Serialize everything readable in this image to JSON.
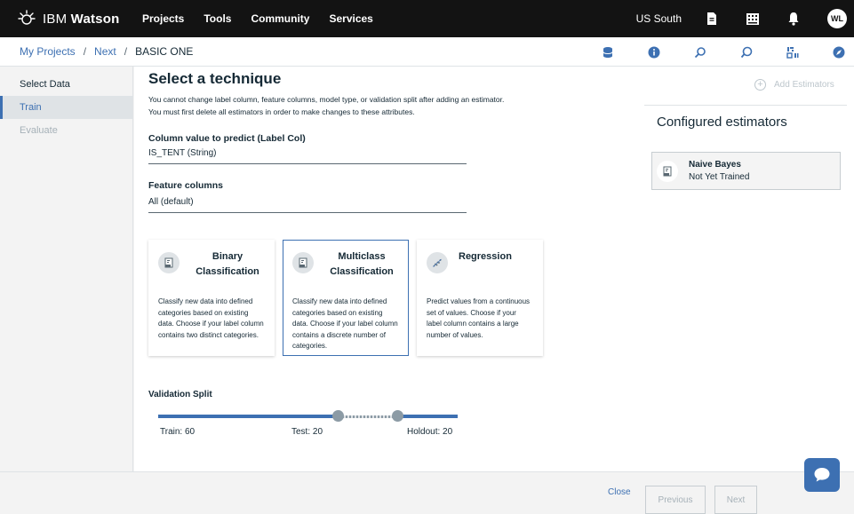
{
  "topbar": {
    "brand_light": "IBM ",
    "brand_bold": "Watson",
    "nav": [
      "Projects",
      "Tools",
      "Community",
      "Services"
    ],
    "region": "US South",
    "avatar_initials": "WL",
    "icons": [
      "document-icon",
      "apps-grid-icon",
      "notification-bell-icon"
    ]
  },
  "breadcrumb": {
    "items": [
      "My Projects",
      "Next"
    ],
    "separator": "/",
    "current": "BASIC ONE"
  },
  "toolbar_icons": [
    "database-icon",
    "info-icon",
    "search-icon",
    "comment-icon",
    "code-icon",
    "compass-icon"
  ],
  "sidebar": {
    "items": [
      {
        "label": "Select Data",
        "state": "normal"
      },
      {
        "label": "Train",
        "state": "active"
      },
      {
        "label": "Evaluate",
        "state": "disabled"
      }
    ]
  },
  "main": {
    "title": "Select a technique",
    "notice_line1": "You cannot change label column, feature columns, model type, or validation split after adding an estimator.",
    "notice_line2": "You must first delete all estimators in order to make changes to these attributes.",
    "label_col": {
      "label": "Column value to predict (Label Col)",
      "value": "IS_TENT (String)"
    },
    "feature_col": {
      "label": "Feature columns",
      "value": "All (default)"
    },
    "techniques": [
      {
        "title": "Binary Classification",
        "description": "Classify new data into defined categories based on existing data. Choose if your label column contains two distinct categories.",
        "selected": false
      },
      {
        "title": "Multiclass Classification",
        "description": "Classify new data into defined categories based on existing data. Choose if your label column contains a discrete number of categories.",
        "selected": true
      },
      {
        "title": "Regression",
        "description": "Predict values from a continuous set of values. Choose if your label column contains a large number of values.",
        "selected": false
      }
    ],
    "validation_split": {
      "label": "Validation Split",
      "train": {
        "text": "Train: 60",
        "value": 60
      },
      "test": {
        "text": "Test: 20",
        "value": 20
      },
      "holdout": {
        "text": "Holdout: 20",
        "value": 20
      }
    }
  },
  "right_panel": {
    "add_label": "Add Estimators",
    "title": "Configured estimators",
    "estimators": [
      {
        "name": "Naive Bayes",
        "status": "Not Yet Trained"
      }
    ]
  },
  "footer": {
    "close": "Close",
    "previous": "Previous",
    "next": "Next"
  },
  "colors": {
    "accent": "#3d70b2",
    "topbar": "#131313",
    "background": "#f3f3f3"
  }
}
